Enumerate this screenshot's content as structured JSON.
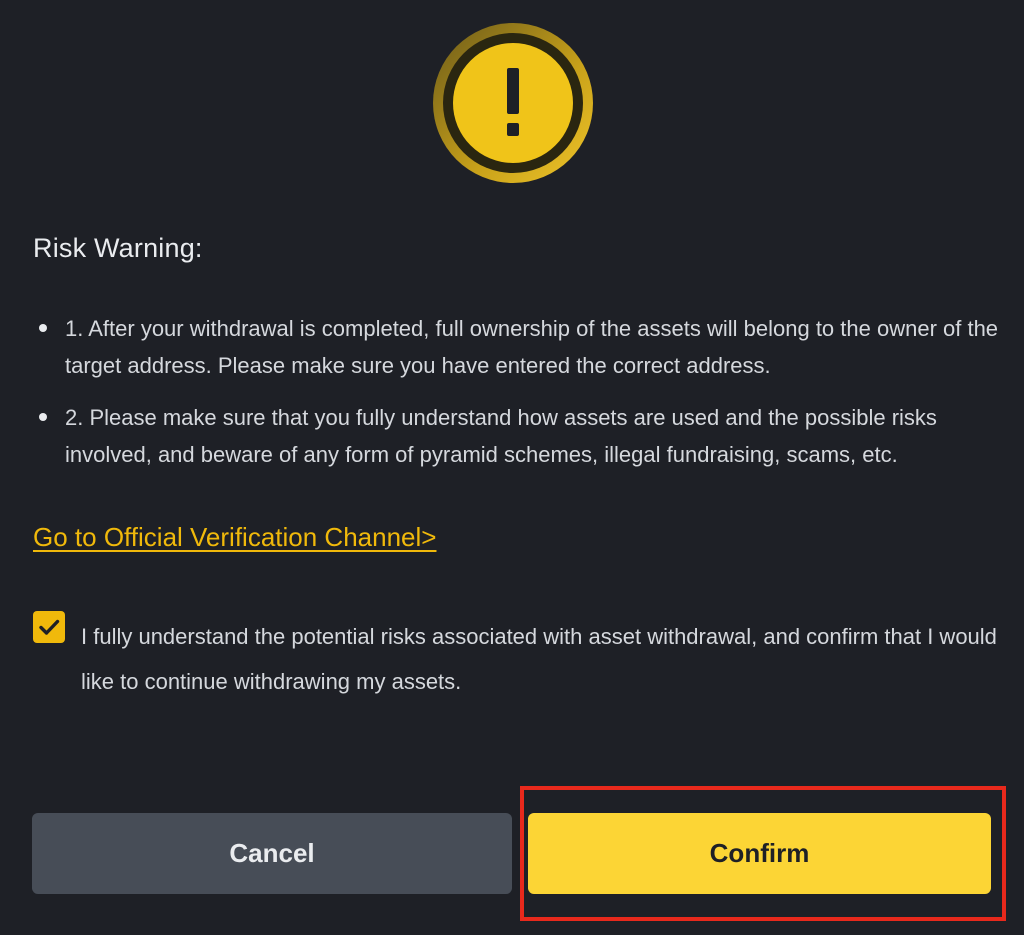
{
  "dialog": {
    "icon": "warning-exclamation-icon",
    "title": "Risk Warning:",
    "items": [
      "1. After your withdrawal is completed, full ownership of the assets will belong to the owner of the target address. Please make sure you have entered the correct address.",
      "2. Please make sure that you fully understand how assets are used and the possible risks involved, and beware of any form of pyramid schemes, illegal fundraising, scams, etc."
    ],
    "verification_link": "Go to Official Verification Channel>",
    "consent": {
      "checked": true,
      "text": "I fully understand the potential risks associated with asset withdrawal, and confirm that I would like to continue withdrawing my assets."
    },
    "buttons": {
      "cancel": "Cancel",
      "confirm": "Confirm"
    }
  },
  "colors": {
    "background": "#1e2026",
    "accent": "#f0b90b",
    "confirm_button": "#fcd535",
    "cancel_button": "#474d57",
    "highlight_outline": "#e8291c"
  }
}
